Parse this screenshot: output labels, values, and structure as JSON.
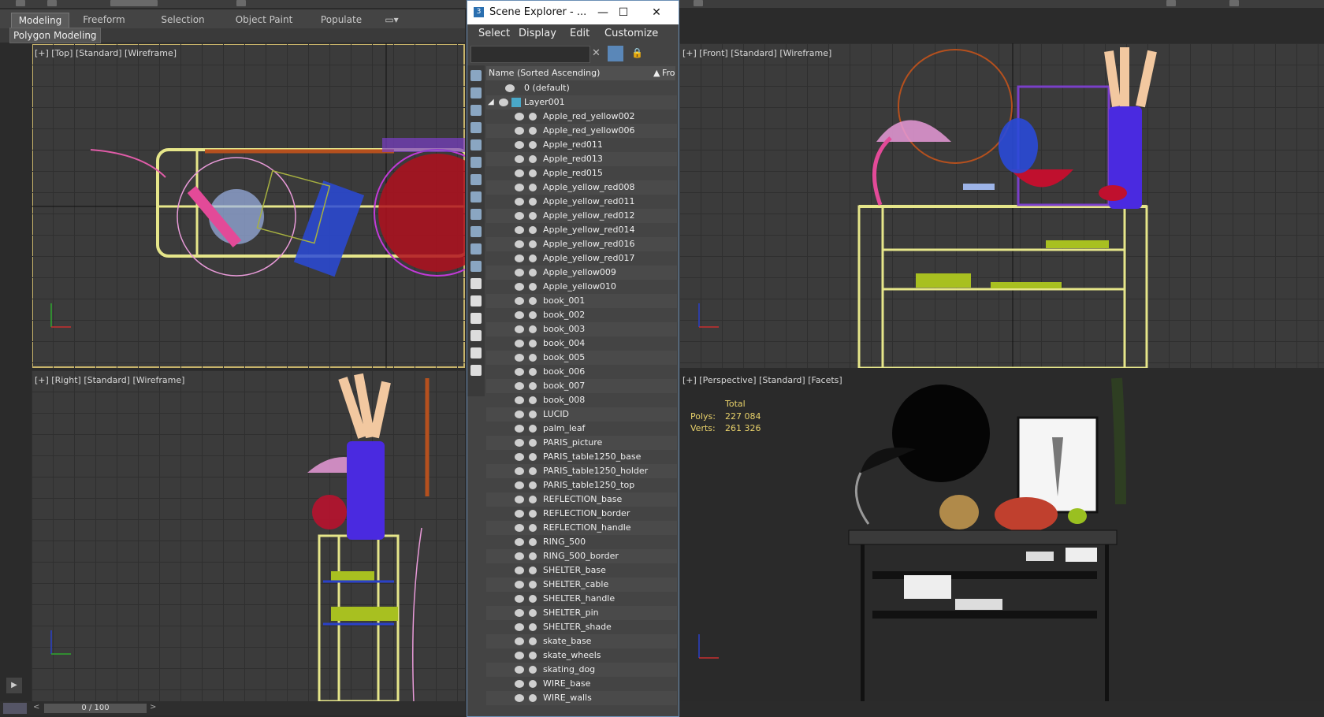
{
  "ribbon": {
    "tabs": [
      "Modeling",
      "Freeform",
      "Selection",
      "Object Paint",
      "Populate"
    ],
    "active_tab": "Modeling",
    "subpanel": "Polygon Modeling"
  },
  "viewports": {
    "top": "[+] [Top] [Standard] [Wireframe]",
    "front": "[+] [Front] [Standard] [Wireframe]",
    "right": "[+] [Right] [Standard] [Wireframe]",
    "perspective": "[+] [Perspective] [Standard] [Facets]"
  },
  "stats": {
    "total_label": "Total",
    "polys_label": "Polys:",
    "polys_value": "227 084",
    "verts_label": "Verts:",
    "verts_value": "261 326"
  },
  "scene_explorer": {
    "title": "Scene Explorer - ...",
    "menu": [
      "Select",
      "Display",
      "Edit",
      "Customize"
    ],
    "column_header": "Name (Sorted Ascending)",
    "column_header2": "Fro",
    "layers": [
      "0 (default)",
      "Layer001"
    ],
    "objects": [
      "Apple_red_yellow002",
      "Apple_red_yellow006",
      "Apple_red011",
      "Apple_red013",
      "Apple_red015",
      "Apple_yellow_red008",
      "Apple_yellow_red011",
      "Apple_yellow_red012",
      "Apple_yellow_red014",
      "Apple_yellow_red016",
      "Apple_yellow_red017",
      "Apple_yellow009",
      "Apple_yellow010",
      "book_001",
      "book_002",
      "book_003",
      "book_004",
      "book_005",
      "book_006",
      "book_007",
      "book_008",
      "LUCID",
      "palm_leaf",
      "PARIS_picture",
      "PARIS_table1250_base",
      "PARIS_table1250_holder",
      "PARIS_table1250_top",
      "REFLECTION_base",
      "REFLECTION_border",
      "REFLECTION_handle",
      "RING_500",
      "RING_500_border",
      "SHELTER_base",
      "SHELTER_cable",
      "SHELTER_handle",
      "SHELTER_pin",
      "SHELTER_shade",
      "skate_base",
      "skate_wheels",
      "skating_dog",
      "WIRE_base",
      "WIRE_walls"
    ]
  },
  "timeline": {
    "frame": "0 / 100"
  },
  "colors": {
    "active_border": "#c8b46a",
    "explorer_border": "#6b8fb5",
    "stat_text": "#e8d16a"
  }
}
